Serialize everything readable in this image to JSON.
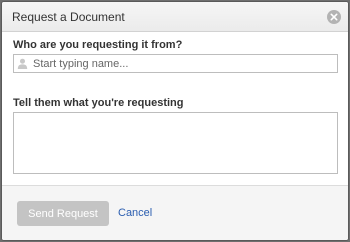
{
  "dialog": {
    "title": "Request a Document",
    "close_icon": "close-circle-icon"
  },
  "from": {
    "label": "Who are you requesting it from?",
    "icon": "person-icon",
    "placeholder": "Start typing name...",
    "value": ""
  },
  "what": {
    "label": "Tell them what you're requesting",
    "value": ""
  },
  "footer": {
    "send_label": "Send Request",
    "cancel_label": "Cancel"
  },
  "colors": {
    "link": "#2a5db0",
    "disabled_button": "#c4c4c4"
  }
}
